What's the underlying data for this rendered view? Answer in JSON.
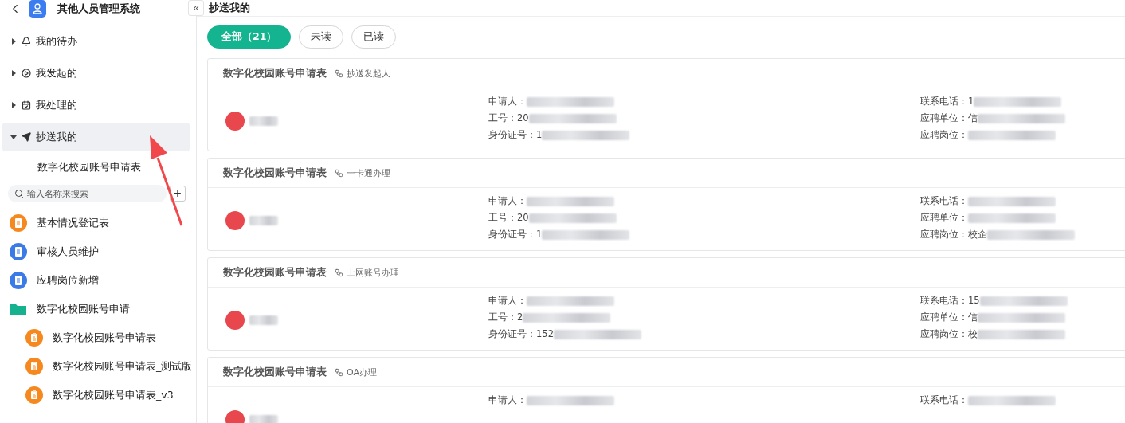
{
  "app": {
    "title": "其他人员管理系统"
  },
  "nav": [
    {
      "label": "我的待办",
      "kind": "bell",
      "expanded": false,
      "selected": false
    },
    {
      "label": "我发起的",
      "kind": "play",
      "expanded": false,
      "selected": false
    },
    {
      "label": "我处理的",
      "kind": "calendar",
      "expanded": false,
      "selected": false
    },
    {
      "label": "抄送我的",
      "kind": "send",
      "expanded": true,
      "selected": true,
      "children": [
        {
          "label": "数字化校园账号申请表"
        }
      ]
    }
  ],
  "search": {
    "placeholder": "输入名称来搜索",
    "add_label": "+"
  },
  "forms": [
    {
      "label": "基本情况登记表",
      "kind": "form",
      "color": "#f5891f"
    },
    {
      "label": "审核人员维护",
      "kind": "form",
      "color": "#3a7be8"
    },
    {
      "label": "应聘岗位新增",
      "kind": "form",
      "color": "#3a7be8"
    },
    {
      "label": "数字化校园账号申请",
      "kind": "folder",
      "color": "#16b28f",
      "children": [
        {
          "label": "数字化校园账号申请表",
          "kind": "clipboard",
          "color": "#f5891f"
        },
        {
          "label": "数字化校园账号申请表_测试版",
          "kind": "clipboard",
          "color": "#f5891f"
        },
        {
          "label": "数字化校园账号申请表_v3",
          "kind": "clipboard",
          "color": "#f5891f"
        }
      ]
    }
  ],
  "page": {
    "collapse_label": "«",
    "title": "抄送我的"
  },
  "filters": [
    {
      "label": "全部（21）",
      "selected": true
    },
    {
      "label": "未读",
      "selected": false
    },
    {
      "label": "已读",
      "selected": false
    }
  ],
  "cards": [
    {
      "title": "数字化校园账号申请表",
      "node": "抄送发起人",
      "left": [
        {
          "label": "申请人："
        },
        {
          "label": "工号：",
          "prefix": "20"
        },
        {
          "label": "身份证号：",
          "prefix": "1"
        }
      ],
      "right": [
        {
          "label": "联系电话：",
          "prefix": "1"
        },
        {
          "label": "应聘单位：",
          "prefix": "信"
        },
        {
          "label": "应聘岗位："
        }
      ]
    },
    {
      "title": "数字化校园账号申请表",
      "node": "一卡通办理",
      "left": [
        {
          "label": "申请人："
        },
        {
          "label": "工号：",
          "prefix": "20"
        },
        {
          "label": "身份证号：",
          "prefix": "1"
        }
      ],
      "right": [
        {
          "label": "联系电话："
        },
        {
          "label": "应聘单位："
        },
        {
          "label": "应聘岗位：",
          "prefix": "校企"
        }
      ]
    },
    {
      "title": "数字化校园账号申请表",
      "node": "上网账号办理",
      "left": [
        {
          "label": "申请人："
        },
        {
          "label": "工号：",
          "prefix": "2"
        },
        {
          "label": "身份证号：",
          "prefix": "152"
        }
      ],
      "right": [
        {
          "label": "联系电话：",
          "prefix": "15"
        },
        {
          "label": "应聘单位：",
          "prefix": "信"
        },
        {
          "label": "应聘岗位：",
          "prefix": "校"
        }
      ]
    },
    {
      "title": "数字化校园账号申请表",
      "node": "OA办理",
      "left": [
        {
          "label": "申请人："
        }
      ],
      "right": [
        {
          "label": "联系电话："
        }
      ]
    }
  ],
  "annotation": {
    "kind": "arrow"
  }
}
